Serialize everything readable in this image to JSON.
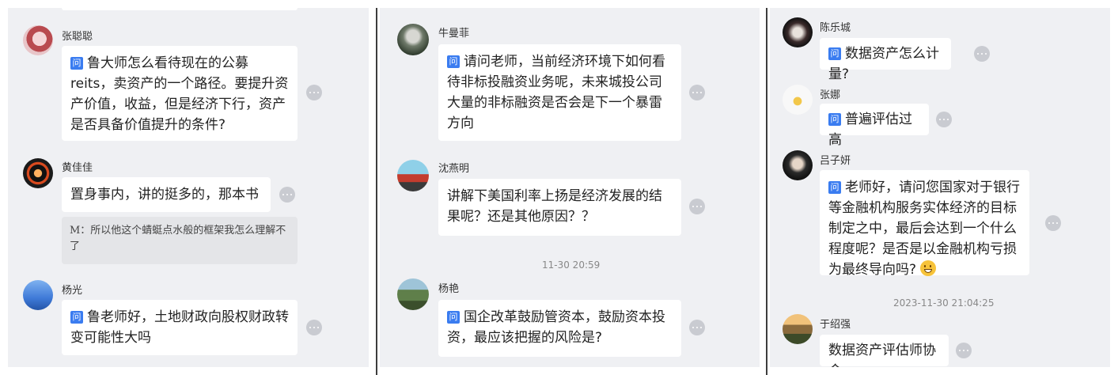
{
  "question_tag": "问",
  "columns": [
    {
      "messages": [
        {
          "name": "张聪聪",
          "text": "鲁大师怎么看待现在的公募reits，卖资产的一个路径。要提升资产价值，收益，但是经济下行，资产是否具备价值提升的条件?",
          "question": true
        },
        {
          "name": "黄佳佳",
          "text": "置身事内，讲的挺多的，那本书",
          "question": false,
          "quote": "M：所以他这个蜻蜓点水般的框架我怎么理解不了"
        },
        {
          "name": "杨光",
          "text": "鲁老师好，土地财政向股权财政转变可能性大吗",
          "question": true
        }
      ]
    },
    {
      "messages": [
        {
          "name": "牛曼菲",
          "text": "请问老师，当前经济环境下如何看待非标投融资业务呢，未来城投公司大量的非标融资是否会是下一个暴雷方向",
          "question": true
        },
        {
          "name": "沈燕明",
          "text": "讲解下美国利率上扬是经济发展的结果呢？还是其他原因？？",
          "question": false
        },
        {
          "name": "杨艳",
          "text": "国企改革鼓励管资本，鼓励资本投资，最应该把握的风险是?",
          "question": true
        }
      ],
      "timestamp": "11-30 20:59"
    },
    {
      "messages": [
        {
          "name": "陈乐城",
          "text": "数据资产怎么计量?",
          "question": true
        },
        {
          "name": "张娜",
          "text": "普遍评估过高",
          "question": true
        },
        {
          "name": "吕子妍",
          "text": "老师好，请问您国家对于银行等金融机构服务实体经济的目标制定之中，最后会达到一个什么程度呢？是否是以金融机构亏损为最终导向吗?",
          "question": true,
          "emoji": "grinning-face"
        },
        {
          "name": "于绍强",
          "text": "数据资产评估师协会",
          "question": false
        }
      ],
      "timestamp": "2023-11-30 21:04:25"
    }
  ],
  "icons": {
    "more": "more-options-icon",
    "question": "question-tag-icon"
  },
  "colors": {
    "panel_bg": "#eff0f3",
    "bubble_bg": "#ffffff",
    "tag_blue": "#3a7cf0",
    "divider": "#3d3d3d"
  }
}
